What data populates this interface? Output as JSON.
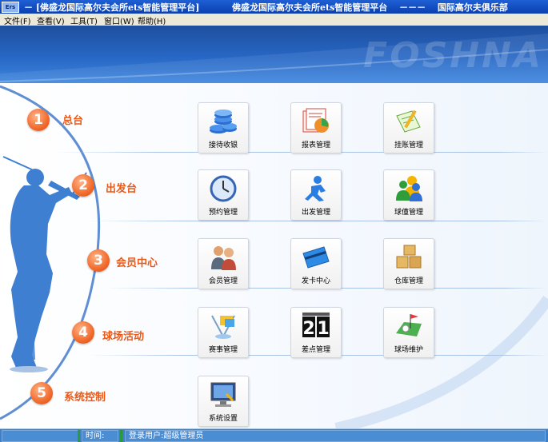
{
  "window": {
    "app_icon_text": "Ers",
    "title": "－ [佛盛龙国际高尔夫会所ets智能管理平台]",
    "title_center": "佛盛龙国际高尔夫会所ets智能管理平台　 －－－　 国际高尔夫俱乐部"
  },
  "menu": [
    "文件(F)",
    "查看(V)",
    "工具(T)",
    "窗口(W)",
    "帮助(H)"
  ],
  "banner": {
    "brand": "FOSHNA"
  },
  "sections": [
    {
      "num": "1",
      "label": "总台"
    },
    {
      "num": "2",
      "label": "出发台"
    },
    {
      "num": "3",
      "label": "会员中心"
    },
    {
      "num": "4",
      "label": "球场活动"
    },
    {
      "num": "5",
      "label": "系统控制"
    }
  ],
  "tiles": {
    "reception": "接待收银",
    "reports": "报表管理",
    "credit": "挂账管理",
    "booking": "预约管理",
    "departure": "出发管理",
    "caddie": "球僮管理",
    "member": "会员管理",
    "card": "发卡中心",
    "warehouse": "仓库管理",
    "tournament": "赛事管理",
    "handicap": "差点管理",
    "course": "球场维护",
    "settings": "系统设置"
  },
  "scoreboard": {
    "left": "2",
    "right": "1"
  },
  "status": {
    "time_label": "时间:",
    "user_label": "登录用户:超级管理员"
  },
  "colors": {
    "title_blue": "#0a3fb0",
    "banner_blue": "#2767c5",
    "accent_orange": "#f26a2c",
    "status_blue": "#3d80c8"
  }
}
